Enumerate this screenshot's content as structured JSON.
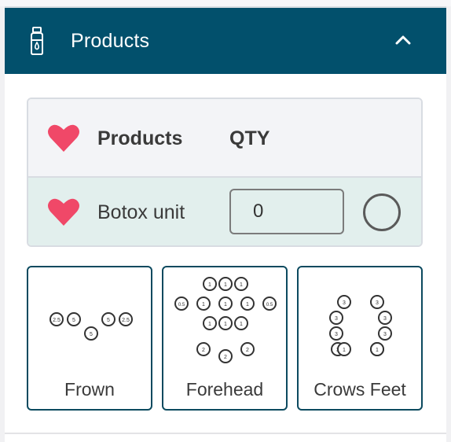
{
  "header": {
    "title": "Products",
    "icon": "bottle-icon",
    "toggle_icon": "chevron-up-icon",
    "background": "#02506c"
  },
  "table": {
    "columns": [
      "Products",
      "QTY"
    ],
    "rows": [
      {
        "product": "Botox unit",
        "qty_value": "0",
        "favorite": true
      }
    ],
    "heart_color": "#f04868"
  },
  "templates": [
    {
      "label": "Frown",
      "points": [
        "2.5",
        "5",
        "5",
        "5",
        "2.5"
      ]
    },
    {
      "label": "Forehead",
      "points": [
        "1",
        "1",
        "1",
        "0.5",
        "1",
        "1",
        "1",
        "0.5",
        "1",
        "1",
        "1",
        "2",
        "2",
        "2"
      ]
    },
    {
      "label": "Crows Feet",
      "points": [
        "3",
        "3",
        "3",
        "3",
        "1",
        "3",
        "3",
        "3",
        "3",
        "1"
      ]
    }
  ]
}
